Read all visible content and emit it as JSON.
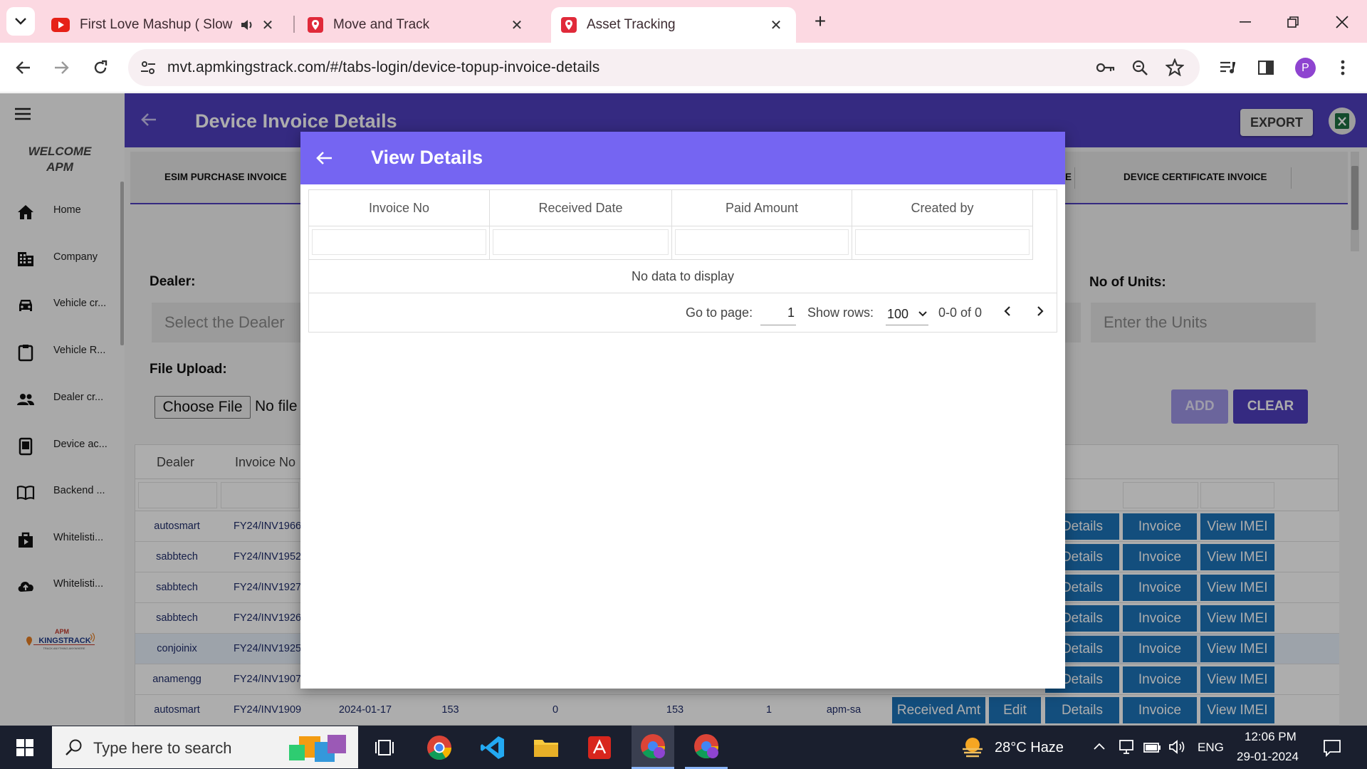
{
  "browser": {
    "tabs": [
      {
        "title": "First Love Mashup ( Slowed",
        "active": false
      },
      {
        "title": "Move and Track",
        "active": false
      },
      {
        "title": "Asset Tracking",
        "active": true
      }
    ],
    "url": "mvt.apmkingstrack.com/#/tabs-login/device-topup-invoice-details",
    "profile_initial": "P"
  },
  "sidebar": {
    "welcome_line1": "WELCOME",
    "welcome_line2": "APM",
    "items": [
      {
        "label": "Home",
        "icon": "home-icon"
      },
      {
        "label": "Company",
        "icon": "company-icon"
      },
      {
        "label": "Vehicle cr...",
        "icon": "car-icon"
      },
      {
        "label": "Vehicle R...",
        "icon": "clipboard-icon"
      },
      {
        "label": "Dealer cr...",
        "icon": "people-icon"
      },
      {
        "label": "Device ac...",
        "icon": "device-icon"
      },
      {
        "label": "Backend ...",
        "icon": "book-icon"
      },
      {
        "label": "Whitelisti...",
        "icon": "whitelist-icon"
      },
      {
        "label": "Whitelisti...",
        "icon": "cloud-upload-icon"
      }
    ],
    "logo_top": "APM",
    "logo_main": "KINGSTRACK",
    "logo_tag": "TRACK ANYTHING ANYWHERE"
  },
  "header": {
    "title": "Device Invoice Details",
    "export_label": "EXPORT"
  },
  "page_tabs": {
    "left": "ESIM PURCHASE INVOICE",
    "partial": "E",
    "right": "DEVICE CERTIFICATE INVOICE"
  },
  "form": {
    "dealer_label": "Dealer:",
    "dealer_placeholder": "Select the Dealer",
    "file_label": "File Upload:",
    "choose_file": "Choose File",
    "no_file": "No file",
    "units_label": "No of Units:",
    "units_placeholder": "Enter the Units",
    "add_label": "ADD",
    "clear_label": "CLEAR"
  },
  "table": {
    "headers": [
      "Dealer",
      "Invoice No"
    ],
    "rows": [
      {
        "dealer": "autosmart",
        "invoice": "FY24/INV1966"
      },
      {
        "dealer": "sabbtech",
        "invoice": "FY24/INV1952"
      },
      {
        "dealer": "sabbtech",
        "invoice": "FY24/INV1927"
      },
      {
        "dealer": "sabbtech",
        "invoice": "FY24/INV1926"
      },
      {
        "dealer": "conjoinix",
        "invoice": "FY24/INV1925"
      },
      {
        "dealer": "anamengg",
        "invoice": "FY24/INV1907"
      },
      {
        "dealer": "autosmart",
        "invoice": "FY24/INV1909",
        "date": "2024-01-17",
        "c1": "153",
        "c2": "0",
        "c3": "153",
        "c4": "1",
        "by": "apm-sa"
      }
    ],
    "action_labels": {
      "received": "Received Amt",
      "edit": "Edit",
      "details": "Details",
      "invoice": "Invoice",
      "imei": "View IMEI"
    }
  },
  "modal": {
    "title": "View Details",
    "headers": [
      "Invoice No",
      "Received Date",
      "Paid Amount",
      "Created by"
    ],
    "empty_text": "No data to display",
    "go_to_page_label": "Go to page:",
    "page_value": "1",
    "show_rows_label": "Show rows:",
    "rows_value": "100",
    "range_text": "0-0 of 0"
  },
  "taskbar": {
    "search_placeholder": "Type here to search",
    "weather": "28°C  Haze",
    "lang": "ENG",
    "time": "12:06 PM",
    "date": "29-01-2024"
  }
}
